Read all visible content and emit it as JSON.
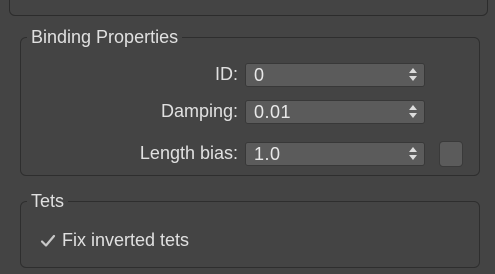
{
  "binding_properties": {
    "title": "Binding Properties",
    "fields": [
      {
        "label": "ID:",
        "value": "0"
      },
      {
        "label": "Damping:",
        "value": "0.01"
      },
      {
        "label": "Length bias:",
        "value": "1.0"
      }
    ],
    "swatch_color": "#5b5b5b"
  },
  "tets": {
    "title": "Tets",
    "fix_inverted": {
      "label": "Fix inverted tets",
      "checked": true
    }
  },
  "theme": {
    "background": "#444444",
    "field_background": "#5b5b5b",
    "text": "#e0e0e0"
  },
  "icons": {
    "spinner": "up-down-arrows-icon",
    "checkmark": "checkmark-icon"
  }
}
